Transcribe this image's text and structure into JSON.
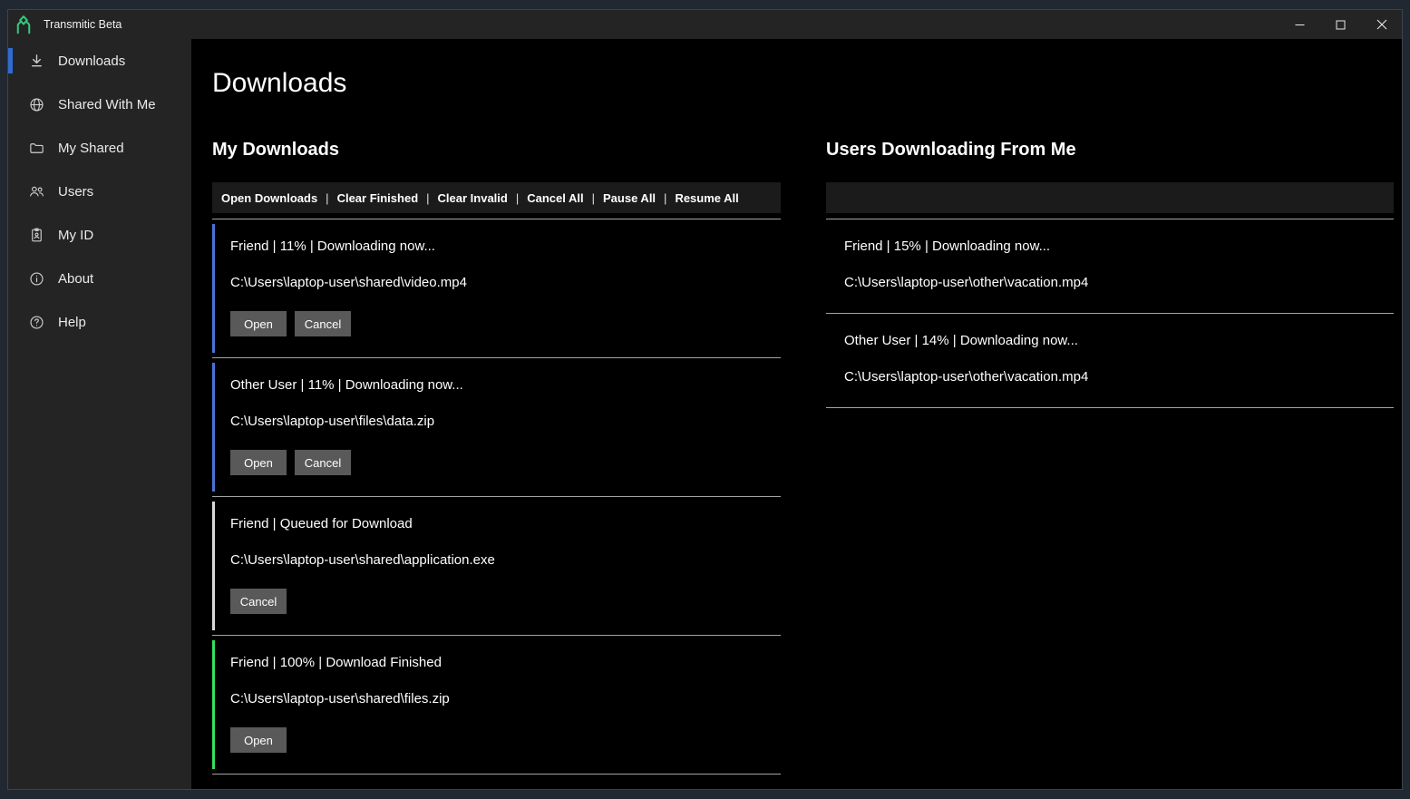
{
  "window": {
    "title": "Transmitic Beta",
    "logo_icon": "transmitic-logo-icon",
    "controls": [
      "minimize-icon",
      "maximize-icon",
      "close-icon"
    ]
  },
  "sidebar": {
    "items": [
      {
        "label": "Downloads",
        "icon": "download-icon",
        "active": true
      },
      {
        "label": "Shared With Me",
        "icon": "globe-icon",
        "active": false
      },
      {
        "label": "My Shared",
        "icon": "folder-icon",
        "active": false
      },
      {
        "label": "Users",
        "icon": "users-icon",
        "active": false
      },
      {
        "label": "My ID",
        "icon": "id-badge-icon",
        "active": false
      },
      {
        "label": "About",
        "icon": "info-icon",
        "active": false
      },
      {
        "label": "Help",
        "icon": "help-icon",
        "active": false
      }
    ]
  },
  "main": {
    "page_title": "Downloads",
    "my_downloads": {
      "heading": "My Downloads",
      "toolbar_links": [
        "Open Downloads",
        "Clear Finished",
        "Clear Invalid",
        "Cancel All",
        "Pause All",
        "Resume All"
      ],
      "toolbar_separator": "|",
      "items": [
        {
          "status_line": "Friend | 11% | Downloading now...",
          "path": "C:\\Users\\laptop-user\\shared\\video.mp4",
          "state": "downloading",
          "buttons": [
            "Open",
            "Cancel"
          ]
        },
        {
          "status_line": "Other User | 11% | Downloading now...",
          "path": "C:\\Users\\laptop-user\\files\\data.zip",
          "state": "downloading",
          "buttons": [
            "Open",
            "Cancel"
          ]
        },
        {
          "status_line": "Friend | Queued for Download",
          "path": "C:\\Users\\laptop-user\\shared\\application.exe",
          "state": "queued",
          "buttons": [
            "Cancel"
          ]
        },
        {
          "status_line": "Friend | 100% | Download Finished",
          "path": "C:\\Users\\laptop-user\\shared\\files.zip",
          "state": "finished",
          "buttons": [
            "Open"
          ]
        }
      ]
    },
    "users_downloading_from_me": {
      "heading": "Users Downloading From Me",
      "items": [
        {
          "status_line": "Friend | 15% | Downloading now...",
          "path": "C:\\Users\\laptop-user\\other\\vacation.mp4"
        },
        {
          "status_line": "Other User | 14% | Downloading now...",
          "path": "C:\\Users\\laptop-user\\other\\vacation.mp4"
        }
      ]
    }
  },
  "colors": {
    "accent_blue": "#2f6bd2",
    "downloading_blue": "#4a74d4",
    "queued_gray": "#d9d9d9",
    "finished_green": "#35df63",
    "logo_green": "#35c97d",
    "titlebar_bg": "#242424",
    "sidebar_bg": "#242424",
    "main_bg": "#000000",
    "toolbar_bg": "#1b1b1b",
    "button_bg": "#595959",
    "separator_gray": "#a3a3a3",
    "frame_bg": "#212831"
  }
}
